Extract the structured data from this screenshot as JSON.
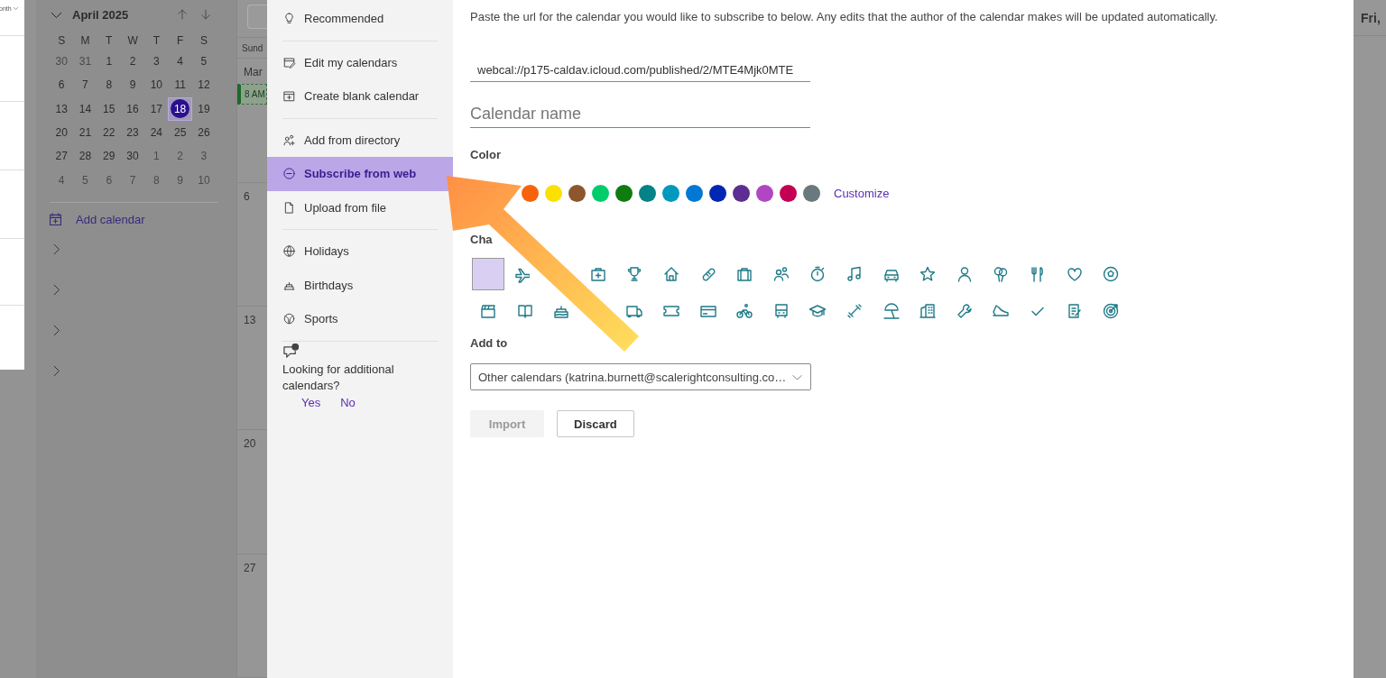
{
  "left_panel": {
    "view_label": "onth"
  },
  "mini_calendar": {
    "title": "April 2025",
    "weekdays": [
      "S",
      "M",
      "T",
      "W",
      "T",
      "F",
      "S"
    ],
    "days": [
      {
        "label": "30",
        "in_month": false,
        "selected": false
      },
      {
        "label": "31",
        "in_month": false,
        "selected": false
      },
      {
        "label": "1",
        "in_month": true,
        "selected": false
      },
      {
        "label": "2",
        "in_month": true,
        "selected": false
      },
      {
        "label": "3",
        "in_month": true,
        "selected": false
      },
      {
        "label": "4",
        "in_month": true,
        "selected": false
      },
      {
        "label": "5",
        "in_month": true,
        "selected": false
      },
      {
        "label": "6",
        "in_month": true,
        "selected": false
      },
      {
        "label": "7",
        "in_month": true,
        "selected": false
      },
      {
        "label": "8",
        "in_month": true,
        "selected": false
      },
      {
        "label": "9",
        "in_month": true,
        "selected": false
      },
      {
        "label": "10",
        "in_month": true,
        "selected": false
      },
      {
        "label": "11",
        "in_month": true,
        "selected": false
      },
      {
        "label": "12",
        "in_month": true,
        "selected": false
      },
      {
        "label": "13",
        "in_month": true,
        "selected": false
      },
      {
        "label": "14",
        "in_month": true,
        "selected": false
      },
      {
        "label": "15",
        "in_month": true,
        "selected": false
      },
      {
        "label": "16",
        "in_month": true,
        "selected": false
      },
      {
        "label": "17",
        "in_month": true,
        "selected": false
      },
      {
        "label": "18",
        "in_month": true,
        "selected": true
      },
      {
        "label": "19",
        "in_month": true,
        "selected": false
      },
      {
        "label": "20",
        "in_month": true,
        "selected": false
      },
      {
        "label": "21",
        "in_month": true,
        "selected": false
      },
      {
        "label": "22",
        "in_month": true,
        "selected": false
      },
      {
        "label": "23",
        "in_month": true,
        "selected": false
      },
      {
        "label": "24",
        "in_month": true,
        "selected": false
      },
      {
        "label": "25",
        "in_month": true,
        "selected": false
      },
      {
        "label": "26",
        "in_month": true,
        "selected": false
      },
      {
        "label": "27",
        "in_month": true,
        "selected": false
      },
      {
        "label": "28",
        "in_month": true,
        "selected": false
      },
      {
        "label": "29",
        "in_month": true,
        "selected": false
      },
      {
        "label": "30",
        "in_month": true,
        "selected": false
      },
      {
        "label": "1",
        "in_month": false,
        "selected": false
      },
      {
        "label": "2",
        "in_month": false,
        "selected": false
      },
      {
        "label": "3",
        "in_month": false,
        "selected": false
      },
      {
        "label": "4",
        "in_month": false,
        "selected": false
      },
      {
        "label": "5",
        "in_month": false,
        "selected": false
      },
      {
        "label": "6",
        "in_month": false,
        "selected": false
      },
      {
        "label": "7",
        "in_month": false,
        "selected": false
      },
      {
        "label": "8",
        "in_month": false,
        "selected": false
      },
      {
        "label": "9",
        "in_month": false,
        "selected": false
      },
      {
        "label": "10",
        "in_month": false,
        "selected": false
      }
    ]
  },
  "add_calendar": {
    "label": "Add calendar"
  },
  "groups": [
    {
      "expanded": false
    },
    {
      "expanded": false
    },
    {
      "expanded": false
    },
    {
      "expanded": false
    }
  ],
  "week_grid": {
    "header": "Sund",
    "rows": [
      {
        "label": "Mar",
        "event": "8 AM"
      },
      {
        "label": "6"
      },
      {
        "label": "13"
      },
      {
        "label": "20"
      },
      {
        "label": "27"
      }
    ]
  },
  "dialog": {
    "nav": [
      [
        {
          "label": "Recommended",
          "selected": false
        }
      ],
      [
        {
          "label": "Edit my calendars",
          "selected": false
        },
        {
          "label": "Create blank calendar",
          "selected": false
        }
      ],
      [
        {
          "label": "Add from directory",
          "selected": false
        },
        {
          "label": "Subscribe from web",
          "selected": true
        },
        {
          "label": "Upload from file",
          "selected": false
        }
      ],
      [
        {
          "label": "Holidays",
          "selected": false
        },
        {
          "label": "Birthdays",
          "selected": false
        },
        {
          "label": "Sports",
          "selected": false
        }
      ]
    ],
    "feedback": {
      "question": "Looking for additional calendars?",
      "yes": "Yes",
      "no": "No"
    },
    "description": "Paste the url for the calendar you would like to subscribe to below. Any edits that the author of the calendar makes will be updated automatically.",
    "url_field": {
      "value": "webcal://p175-caldav.icloud.com/published/2/MTE4Mjk0MTE"
    },
    "name_field": {
      "placeholder": "Calendar name"
    },
    "color_label": "Color",
    "colors": [
      {
        "color": "#f7630c"
      },
      {
        "color": "#fce100"
      },
      {
        "color": "#8e562e"
      },
      {
        "color": "#00cc6a"
      },
      {
        "color": "#107c10"
      },
      {
        "color": "#038387"
      },
      {
        "color": "#0099bc"
      },
      {
        "color": "#0078d4"
      },
      {
        "color": "#0027b4"
      },
      {
        "color": "#5c2e91"
      },
      {
        "color": "#b146c2"
      },
      {
        "color": "#c30052"
      },
      {
        "color": "#69797e"
      }
    ],
    "customize": "Customize",
    "charm_label": "Cha",
    "charms": [
      {
        "selected": true
      },
      {
        "selected": false
      },
      {
        "selected": false
      },
      {
        "selected": false
      },
      {
        "selected": false
      },
      {
        "selected": false
      },
      {
        "selected": false
      },
      {
        "selected": false
      },
      {
        "selected": false
      },
      {
        "selected": false
      },
      {
        "selected": false
      },
      {
        "selected": false
      },
      {
        "selected": false
      },
      {
        "selected": false
      },
      {
        "selected": false
      },
      {
        "selected": false
      },
      {
        "selected": false
      },
      {
        "selected": false
      },
      {
        "selected": false
      },
      {
        "selected": false
      },
      {
        "selected": false
      },
      {
        "selected": false
      },
      {
        "selected": false
      },
      {
        "selected": false
      },
      {
        "selected": false
      },
      {
        "selected": false
      },
      {
        "selected": false
      },
      {
        "selected": false
      },
      {
        "selected": false
      },
      {
        "selected": false
      },
      {
        "selected": false
      },
      {
        "selected": false
      },
      {
        "selected": false
      },
      {
        "selected": false
      }
    ],
    "add_to_label": "Add to",
    "add_to": {
      "value": "Other calendars (katrina.burnett@scalerightconsulting.co…"
    },
    "buttons": [
      {
        "label": "Import",
        "disabled": true
      },
      {
        "label": "Discard",
        "disabled": false
      }
    ]
  },
  "right_strip": {
    "header": "Fri,"
  }
}
